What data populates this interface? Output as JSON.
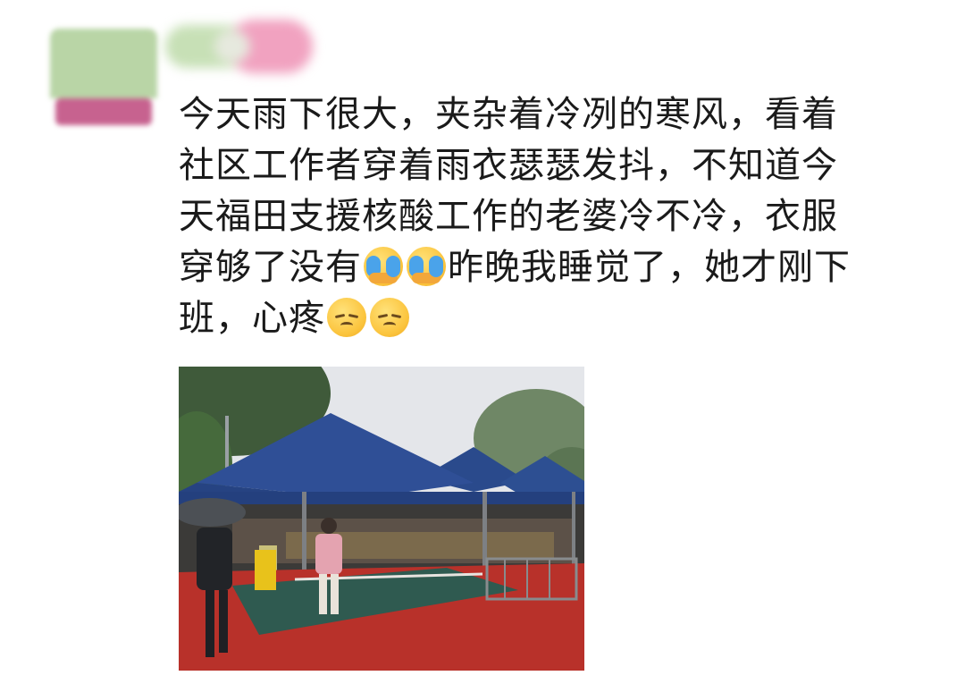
{
  "post": {
    "lines": [
      "今天雨下很大，夹杂着冷冽的寒风，看着",
      "社区工作者穿着雨衣瑟瑟发抖，不知道今",
      "天福田支援核酸工作的老婆冷不冷，衣服",
      "穿够了没有",
      "昨晚我睡觉了，她才刚下",
      "班，心疼"
    ],
    "emoji": {
      "first": "crying-face",
      "second": "pensive-face"
    }
  },
  "colors": {
    "text": "#1a1a1a",
    "ground": "#b8312a",
    "tent": "#2f4f96"
  }
}
